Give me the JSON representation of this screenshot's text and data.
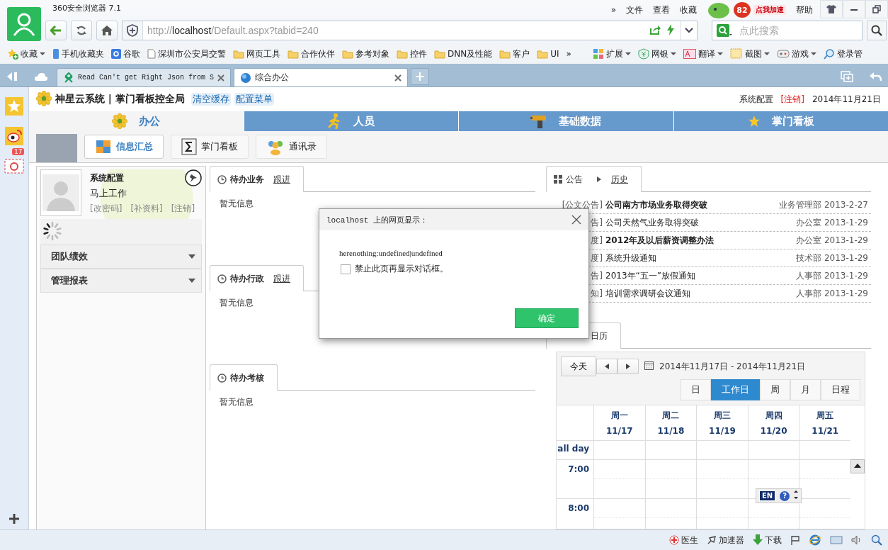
{
  "browser": {
    "title": "360安全浏览器 7.1",
    "menu": [
      "»",
      "文件",
      "查看",
      "收藏",
      "帮助"
    ],
    "speed_badge": "82",
    "speed_label": "点我加速",
    "url": {
      "scheme": "http://",
      "host": "localhost",
      "path": "/Default.aspx?tabid=240"
    },
    "search": {
      "placeholder": "点此搜索"
    },
    "bookmarks": [
      {
        "kind": "favorites",
        "label": "收藏"
      },
      {
        "kind": "mobile",
        "label": "手机收藏夹"
      },
      {
        "kind": "google",
        "label": "谷歌"
      },
      {
        "kind": "page",
        "label": "深圳市公安局交警"
      },
      {
        "kind": "folder",
        "label": "网页工具"
      },
      {
        "kind": "folder",
        "label": "合作伙伴"
      },
      {
        "kind": "folder",
        "label": "参考对象"
      },
      {
        "kind": "folder",
        "label": "控件"
      },
      {
        "kind": "folder",
        "label": "DNN及性能"
      },
      {
        "kind": "folder",
        "label": "客户"
      },
      {
        "kind": "folder",
        "label": "UI"
      },
      {
        "kind": "more",
        "label": "»"
      }
    ],
    "tools": [
      {
        "kind": "extensions",
        "label": "扩展"
      },
      {
        "kind": "bank",
        "label": "网银"
      },
      {
        "kind": "translate",
        "label": "翻译"
      },
      {
        "kind": "screenshot",
        "label": "截图"
      },
      {
        "kind": "games",
        "label": "游戏"
      },
      {
        "kind": "login",
        "label": "登录管"
      }
    ],
    "tabs": [
      {
        "kind": "tree",
        "label": "Read Can't get Right Json from S",
        "selected": false
      },
      {
        "kind": "globe",
        "label": "综合办公",
        "selected": true
      }
    ],
    "side_badge": "17",
    "status": [
      {
        "kind": "doctor",
        "label": "医生"
      },
      {
        "kind": "accelerator",
        "label": "加速器"
      },
      {
        "kind": "download",
        "label": "下载"
      }
    ]
  },
  "page": {
    "title": "神星云系统 | 掌门看板控全局",
    "header_links": [
      "清空缓存",
      "配置菜单"
    ],
    "user": "系统配置",
    "logout": "[注销]",
    "date": "2014年11月21日",
    "nav": [
      {
        "kind": "flower",
        "label": "办公",
        "selected": true
      },
      {
        "kind": "runner",
        "label": "人员",
        "selected": false
      },
      {
        "kind": "drill",
        "label": "基础数据",
        "selected": false
      },
      {
        "kind": "star",
        "label": "掌门看板",
        "selected": false
      }
    ],
    "subnav": [
      {
        "kind": "puzzle",
        "label": "信息汇总",
        "selected": true
      },
      {
        "kind": "sigma",
        "label": "掌门看板",
        "selected": false
      },
      {
        "kind": "people",
        "label": "通讯录",
        "selected": false
      }
    ],
    "profile": {
      "name": "系统配置",
      "status": "马上工作",
      "links": [
        "[改密码]",
        "[补资料]",
        "[注销]"
      ]
    },
    "accordion": [
      {
        "label": "团队绩效",
        "expanded": false
      },
      {
        "label": "管理报表",
        "expanded": false
      }
    ],
    "todo_panels": [
      {
        "title": "待办业务",
        "link": "跟进",
        "body": "暂无信息"
      },
      {
        "title": "待办行政",
        "link": "跟进",
        "body": "暂无信息"
      },
      {
        "title": "待办考核",
        "body": "暂无信息"
      }
    ],
    "notices": {
      "tab": "公告",
      "link": "历史",
      "rows": [
        {
          "category": "[公文公告]",
          "title": "公司南方市场业务取得突破",
          "bold": true,
          "dept": "业务管理部",
          "date": "2013-2-27"
        },
        {
          "category": "告]",
          "title": "公司天然气业务取得突破",
          "bold": false,
          "dept": "办公室",
          "date": "2013-1-29"
        },
        {
          "category": "度]",
          "title": "2012年及以后薪资调整办法",
          "bold": true,
          "dept": "办公室",
          "date": "2013-1-29"
        },
        {
          "category": "度]",
          "title": "系统升级通知",
          "bold": false,
          "dept": "技术部",
          "date": "2013-1-29"
        },
        {
          "category": "告]",
          "title": "2013年“五一”放假通知",
          "bold": false,
          "dept": "人事部",
          "date": "2013-1-29"
        },
        {
          "category": "知]",
          "title": "培训需求调研会议通知",
          "bold": false,
          "dept": "人事部",
          "date": "2013-1-29"
        }
      ]
    },
    "calendar": {
      "tab": "日历",
      "today": "今天",
      "range": "2014年11月17日 - 2014年11月21日",
      "views": [
        {
          "label": "日",
          "selected": false
        },
        {
          "label": "工作日",
          "selected": true
        },
        {
          "label": "周",
          "selected": false
        },
        {
          "label": "月",
          "selected": false
        },
        {
          "label": "日程",
          "selected": false
        }
      ],
      "days": [
        {
          "name": "周一",
          "date": "11/17"
        },
        {
          "name": "周二",
          "date": "11/18"
        },
        {
          "name": "周三",
          "date": "11/19"
        },
        {
          "name": "周四",
          "date": "11/20"
        },
        {
          "name": "周五",
          "date": "11/21"
        }
      ],
      "all_day": "all day",
      "times": [
        "7:00",
        "8:00"
      ]
    },
    "ime": {
      "lang": "EN",
      "help": "?"
    }
  },
  "dialog": {
    "title": "localhost 上的网页显示：",
    "message": "herenothing:undefined|undefined",
    "checkbox": {
      "label": "禁止此页再显示对话框。",
      "checked": false
    },
    "ok": "确定"
  }
}
